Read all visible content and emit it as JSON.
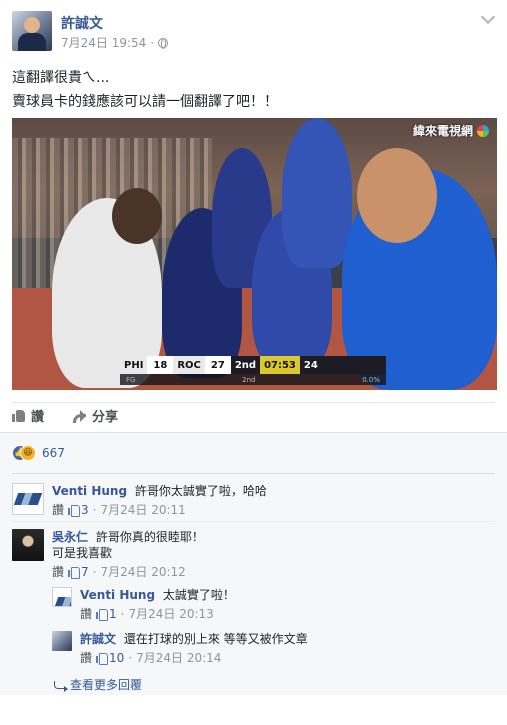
{
  "post": {
    "author": "許誠文",
    "date": "7月24日 19:54",
    "separator": "·",
    "text_line1": "這翻譯很貴ㄟ...",
    "text_line2": "賣球員卡的錢應該可以請一個翻譯了吧！！"
  },
  "image": {
    "scoreboard": {
      "team1": "PHI",
      "score1": "18",
      "team2": "ROC",
      "score2": "27",
      "period": "2nd",
      "clock": "07:53",
      "shot_clock": "24"
    },
    "substat_left": "FG",
    "substat_mid": "2nd",
    "substat_right": "0.0%",
    "channel_logo": "緯來電視網"
  },
  "actions": {
    "like_label": "讚",
    "share_label": "分享"
  },
  "reactions": {
    "count": "667",
    "like_glyph": "👍",
    "haha_glyph": "😆"
  },
  "comments": [
    {
      "author": "Venti Hung",
      "text": "許哥你太誠實了啦，哈哈",
      "like_label": "讚",
      "likes": "3",
      "dot": "·",
      "time": "7月24日 20:11"
    },
    {
      "author": "吳永仁",
      "text": "許哥你真的很睦耶！",
      "text2": "可是我喜歡",
      "like_label": "讚",
      "likes": "7",
      "dot": "·",
      "time": "7月24日 20:12"
    }
  ],
  "replies": [
    {
      "author": "Venti Hung",
      "text": "太誠實了啦！",
      "like_label": "讚",
      "likes": "1",
      "dot": "·",
      "time": "7月24日 20:13"
    },
    {
      "author": "許誠文",
      "text": "還在打球的別上來 等等又被作文章",
      "like_label": "讚",
      "likes": "10",
      "dot": "·",
      "time": "7月24日 20:14"
    }
  ],
  "more_replies_label": "查看更多回覆"
}
